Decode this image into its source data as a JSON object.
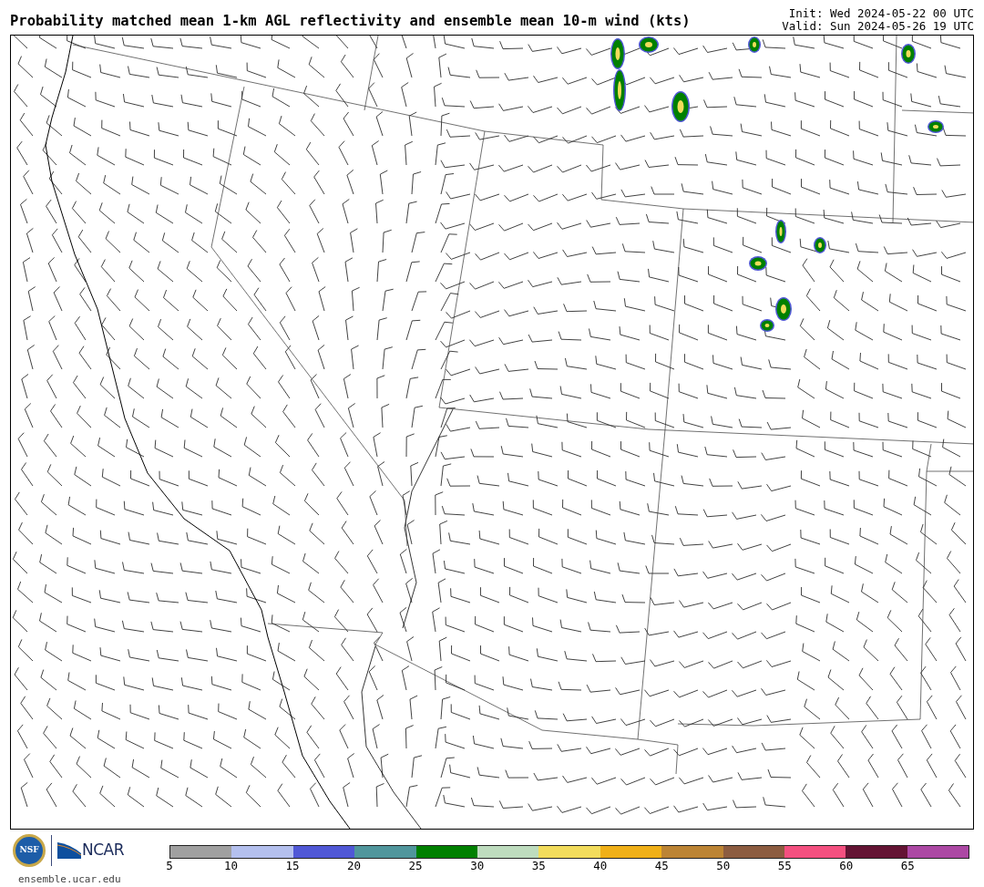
{
  "title": "Probability matched mean 1-km AGL reflectivity and ensemble mean 10-m wind (kts)",
  "init": "Init: Wed 2024-05-22 00 UTC",
  "valid": "Valid: Sun 2024-05-26 19 UTC",
  "logos": {
    "nsf": "NSF",
    "ncar": "NCAR"
  },
  "site": "ensemble.ucar.edu",
  "colorbar": {
    "bins": [
      {
        "color": "#a0a0a0"
      },
      {
        "color": "#b4c0ee"
      },
      {
        "color": "#5058d6"
      },
      {
        "color": "#50969c"
      },
      {
        "color": "#008000"
      },
      {
        "color": "#bedcbe"
      },
      {
        "color": "#f2dc5c"
      },
      {
        "color": "#f0b018"
      },
      {
        "color": "#bc8434"
      },
      {
        "color": "#8c5c40"
      },
      {
        "color": "#f45080"
      },
      {
        "color": "#641434"
      },
      {
        "color": "#ac48a4"
      }
    ],
    "ticks": [
      "5",
      "10",
      "15",
      "20",
      "25",
      "30",
      "35",
      "40",
      "45",
      "50",
      "55",
      "60",
      "65"
    ]
  }
}
